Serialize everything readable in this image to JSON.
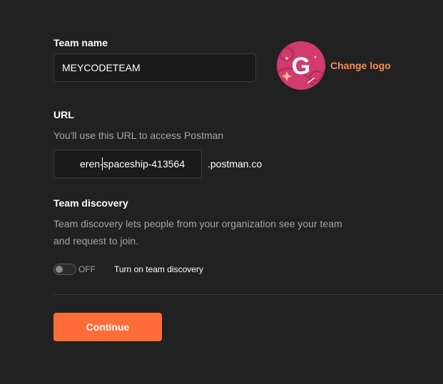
{
  "team_name": {
    "label": "Team name",
    "value": "MEYCODETEAM"
  },
  "logo": {
    "letter": "G",
    "change_label": "Change logo",
    "bg_color": "#d23b6f"
  },
  "url": {
    "label": "URL",
    "hint": "You'll use this URL to access Postman",
    "value": "eren-spaceship-413564",
    "suffix": ".postman.co"
  },
  "discovery": {
    "label": "Team discovery",
    "description_line1": "Team discovery lets people from your organization see your team",
    "description_line2": "and request to join.",
    "toggle_state": "OFF",
    "toggle_on": false,
    "toggle_label": "Turn on team discovery"
  },
  "actions": {
    "continue_label": "Continue",
    "accent_color": "#ff6c37"
  }
}
